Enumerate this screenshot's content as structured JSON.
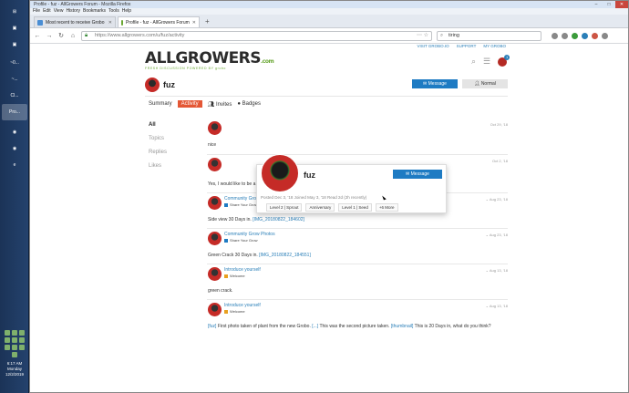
{
  "taskbar": {
    "buttons": [
      "",
      "",
      "",
      "~0...",
      "~...",
      "Cl...",
      "Pro..."
    ],
    "tray": {
      "time": "6:17 AM",
      "day": "Monday",
      "date": "12/2/2019"
    }
  },
  "browser": {
    "title": "Profile - fuz - AllGrowers Forum - Mozilla Firefox",
    "menu": [
      "File",
      "Edit",
      "View",
      "History",
      "Bookmarks",
      "Tools",
      "Help"
    ],
    "tabs": [
      {
        "label": "Most recent to receive Grobo",
        "active": false
      },
      {
        "label": "Profile - fuz - AllGrowers Forum",
        "active": true
      }
    ],
    "url": "https://www.allgrowers.com/u/fuz/activity",
    "search": "tiring"
  },
  "site": {
    "toplinks": [
      "VISIT GROBO.IO",
      "SUPPORT",
      "MY GROBO"
    ],
    "logo_main": "ALLGROWERS",
    "logo_com": ".com",
    "logo_tag": "FRESH DISCUSSION POWERED BY grobo",
    "notification_count": "1"
  },
  "profile": {
    "username": "fuz",
    "message_label": "Message",
    "normal_label": "Normal",
    "tabs": {
      "summary": "Summary",
      "activity": "Activity",
      "invites": "Invites",
      "badges": "Badges"
    },
    "sidebar": [
      "All",
      "Topics",
      "Replies",
      "Likes"
    ]
  },
  "usercard": {
    "name": "fuz",
    "message_label": "Message",
    "meta": "Posted Dec 3, '18  Joined May 3, '18  Read 2d (2h recently)",
    "badges": [
      "Level 2 | Sprout",
      "Anniversary",
      "Level 1 | Seed",
      "+6 More"
    ]
  },
  "posts": [
    {
      "title": "",
      "category": "",
      "date": "Oct 29, '18",
      "body": "nice"
    },
    {
      "title": "",
      "category": "",
      "date": "Oct 2, '18",
      "body": "Yes, I would like to be a BETA program tester. Thank you."
    },
    {
      "title": "Community Grow Photos",
      "category": "Share Your Grow",
      "date": "Aug 23, '18",
      "body_pre": "Side view 30 Days in. ",
      "body_link": "[IMG_20180822_184602]"
    },
    {
      "title": "Community Grow Photos",
      "category": "Share Your Grow",
      "date": "Aug 23, '18",
      "body_pre": "Green Crack 30 Days in. ",
      "body_link": "[IMG_20180822_184551]"
    },
    {
      "title": "Introduce yourself",
      "category": "Welcome",
      "date": "Aug 13, '18",
      "body": "green crack."
    },
    {
      "title": "Introduce yourself",
      "category": "Welcome",
      "date": "Aug 13, '18",
      "body_l1": "[fuz]",
      "body_t1": " First photo taken of plant from the new Grobo. ",
      "body_l2": "[...]",
      "body_t2": " This was the second picture taken. ",
      "body_l3": "[thumbnail]",
      "body_t3": " This is 20 Days in, what do you think?"
    }
  ],
  "colors": {
    "accent": "#1e7bc3",
    "activity_tab": "#e45735",
    "grow_category": "#1e7bc3",
    "welcome_category": "#e8a020"
  }
}
